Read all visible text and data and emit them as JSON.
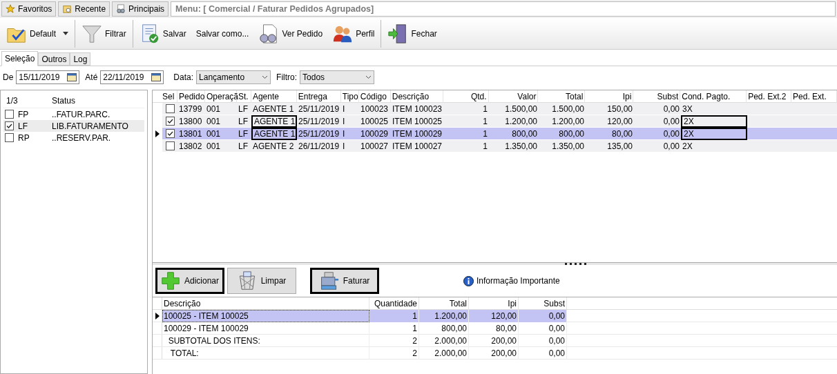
{
  "top_tabs": [
    {
      "label": "Favoritos"
    },
    {
      "label": "Recente"
    },
    {
      "label": "Principais"
    }
  ],
  "menu_path": "Menu: [ Comercial / Faturar Pedidos Agrupados]",
  "toolbar": [
    {
      "label": "Default"
    },
    {
      "label": "Filtrar"
    },
    {
      "label": "Salvar"
    },
    {
      "label": "Salvar como..."
    },
    {
      "label": "Ver Pedido"
    },
    {
      "label": "Perfil"
    },
    {
      "label": "Fechar"
    }
  ],
  "tabs": [
    {
      "label": "Seleção",
      "selected": true
    },
    {
      "label": "Outros",
      "selected": false
    },
    {
      "label": "Log",
      "selected": false
    }
  ],
  "filters": {
    "from_label": "De",
    "from": "15/11/2019",
    "to_label": "Até",
    "to": "22/11/2019",
    "date_label": "Data:",
    "date_value": "Lançamento",
    "filter_label": "Filtro:",
    "filter_value": "Todos"
  },
  "status_panel": {
    "columns": [
      "1/3",
      "Status"
    ],
    "rows": [
      {
        "code": "FP",
        "status": "..FATUR.PARC.",
        "checked": false,
        "selected": false
      },
      {
        "code": "LF",
        "status": "LIB.FATURAMENTO",
        "checked": true,
        "selected": true
      },
      {
        "code": "RP",
        "status": "..RESERV.PAR.",
        "checked": false,
        "selected": false
      }
    ]
  },
  "orders": {
    "select_column": "Sel",
    "columns": [
      "Pedido",
      "Operaçã",
      "St.",
      "Agente",
      "Entrega",
      "Tipo",
      "Código",
      "Descrição",
      "Qtd.",
      "Valor",
      "Total",
      "Ipi",
      "Subst",
      "Cond. Pagto.",
      "Ped. Ext.2",
      "Ped. Ext."
    ],
    "rows": [
      {
        "cells": [
          "13799",
          "001",
          "LF",
          "AGENTE 1",
          "25/11/2019",
          "I",
          "100023",
          "ITEM 100023",
          "1",
          "1.500,00",
          "1.500,00",
          "150,00",
          "0,00",
          "3X"
        ],
        "checked": false,
        "selected": false,
        "outlined": false
      },
      {
        "cells": [
          "13800",
          "001",
          "LF",
          "AGENTE 1",
          "25/11/2019",
          "I",
          "100025",
          "ITEM 100025",
          "1",
          "1.200,00",
          "1.200,00",
          "120,00",
          "0,00",
          "2X"
        ],
        "checked": true,
        "selected": false,
        "outlined": true
      },
      {
        "cells": [
          "13801",
          "001",
          "LF",
          "AGENTE 1",
          "25/11/2019",
          "I",
          "100029",
          "ITEM 100029",
          "1",
          "800,00",
          "800,00",
          "80,00",
          "0,00",
          "2X"
        ],
        "checked": true,
        "selected": true,
        "outlined": true
      },
      {
        "cells": [
          "13802",
          "001",
          "LF",
          "AGENTE 2",
          "26/11/2019",
          "I",
          "100027",
          "ITEM 100027",
          "1",
          "1.350,00",
          "1.350,00",
          "135,00",
          "0,00",
          "2X"
        ],
        "checked": false,
        "selected": false,
        "outlined": false
      }
    ]
  },
  "actions": [
    {
      "label": "Adicionar",
      "outlined": true
    },
    {
      "label": "Limpar",
      "outlined": false
    },
    {
      "label": "Faturar",
      "outlined": true
    }
  ],
  "info_link": "Informação Importante",
  "summary": {
    "columns": [
      "Descrição",
      "Quantidade",
      "Total",
      "Ipi",
      "Subst"
    ],
    "rows": [
      {
        "cells": [
          "100025 - ITEM 100025",
          "1",
          "1.200,00",
          "120,00",
          "0,00"
        ],
        "selected": true
      },
      {
        "cells": [
          "100029 - ITEM 100029",
          "1",
          "800,00",
          "80,00",
          "0,00"
        ],
        "selected": false
      },
      {
        "cells": [
          "  SUBTOTAL DOS ITENS:",
          "2",
          "2.000,00",
          "200,00",
          "0,00"
        ],
        "selected": false
      },
      {
        "cells": [
          "   TOTAL:",
          "2",
          "2.000,00",
          "200,00",
          "0,00"
        ],
        "selected": false
      }
    ]
  }
}
